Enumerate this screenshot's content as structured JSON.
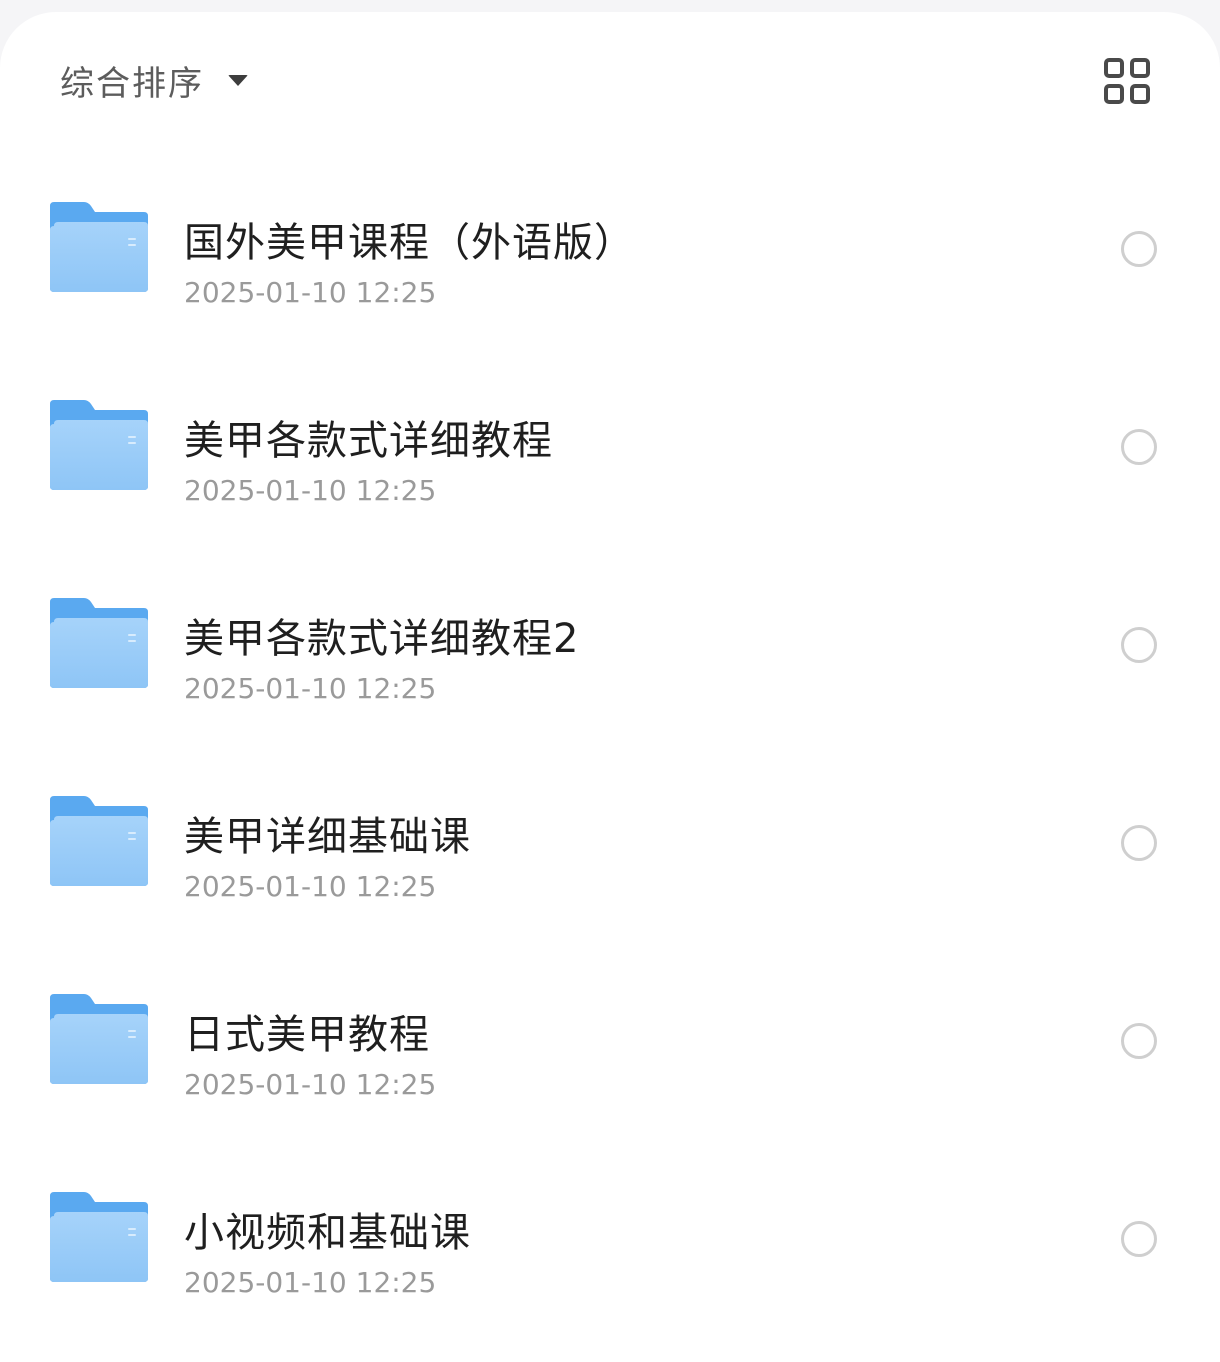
{
  "toolbar": {
    "sort_label": "综合排序",
    "sort_caret_icon": "caret-down-icon",
    "view_toggle_icon": "grid-view-icon"
  },
  "folders": [
    {
      "name": "国外美甲课程（外语版）",
      "date": "2025-01-10 12:25",
      "icon": "folder-icon",
      "selected": false
    },
    {
      "name": "美甲各款式详细教程",
      "date": "2025-01-10 12:25",
      "icon": "folder-icon",
      "selected": false
    },
    {
      "name": "美甲各款式详细教程2",
      "date": "2025-01-10 12:25",
      "icon": "folder-icon",
      "selected": false
    },
    {
      "name": "美甲详细基础课",
      "date": "2025-01-10 12:25",
      "icon": "folder-icon",
      "selected": false
    },
    {
      "name": "日式美甲教程",
      "date": "2025-01-10 12:25",
      "icon": "folder-icon",
      "selected": false
    },
    {
      "name": "小视频和基础课",
      "date": "2025-01-10 12:25",
      "icon": "folder-icon",
      "selected": false
    }
  ],
  "colors": {
    "folder_back": "#5aa9f0",
    "folder_front": "#9ccdf8",
    "radio_border": "#cfcfcf",
    "title_text": "#1f1f1f",
    "date_text": "#9a9a9a"
  }
}
